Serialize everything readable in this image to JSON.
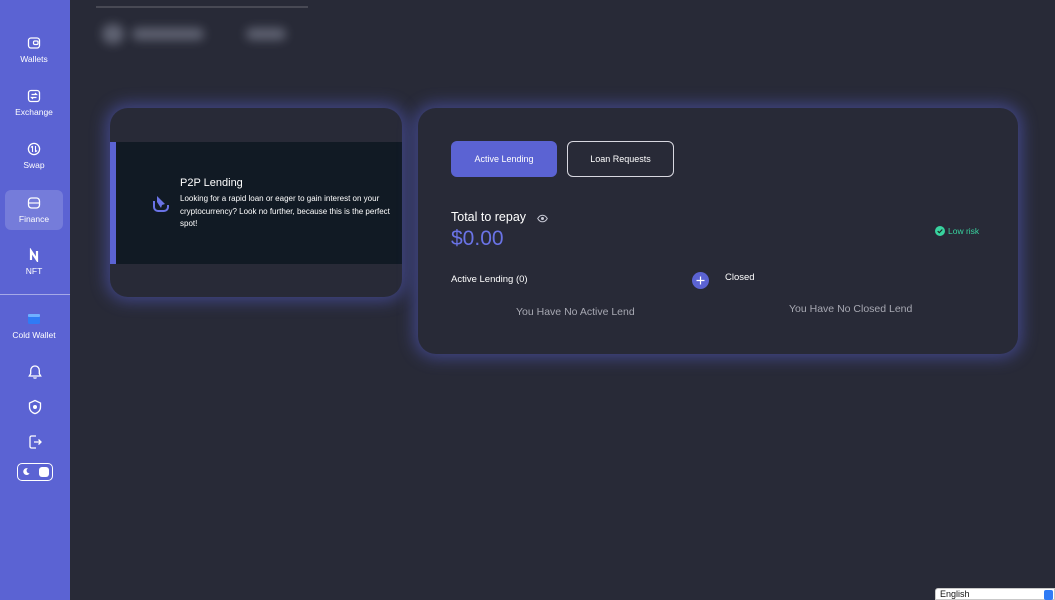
{
  "sidebar": {
    "items": [
      {
        "label": "Wallets",
        "icon": "wallet-icon"
      },
      {
        "label": "Exchange",
        "icon": "exchange-icon"
      },
      {
        "label": "Swap",
        "icon": "swap-icon"
      },
      {
        "label": "Finance",
        "icon": "finance-icon",
        "active": true
      },
      {
        "label": "NFT",
        "icon": "nft-icon"
      },
      {
        "label": "Cold Wallet",
        "icon": "cold-wallet-icon"
      }
    ],
    "bottom_icons": [
      "bell-icon",
      "shield-icon",
      "logout-icon",
      "theme-toggle"
    ]
  },
  "info_card": {
    "title": "P2P Lending",
    "text": "Looking for a rapid loan or eager to gain interest on your cryptocurrency? Look no further, because this is the perfect spot!"
  },
  "main": {
    "tabs": [
      {
        "label": "Active Lending",
        "active": true
      },
      {
        "label": "Loan Requests",
        "active": false
      }
    ],
    "repay_label": "Total to repay",
    "repay_value": "$0.00",
    "risk_label": "Low risk",
    "active_title": "Active Lending (0)",
    "closed_title": "Closed",
    "active_empty": "You Have No Active Lend",
    "closed_empty": "You Have No Closed Lend"
  },
  "language": {
    "selected": "English"
  },
  "colors": {
    "background": "#282a37",
    "sidebar": "#5b63d3",
    "accent": "#5b63d3",
    "value": "#6a73e6",
    "risk": "#38d39f",
    "banner": "#111a24"
  }
}
